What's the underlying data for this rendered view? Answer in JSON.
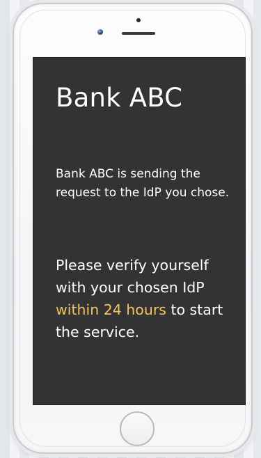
{
  "screen": {
    "title": "Bank ABC",
    "intro": "Bank ABC is sending the request to the IdP you chose.",
    "instruction": {
      "prefix": "Please verify yourself with your chosen IdP ",
      "highlight": "within 24 hours",
      "suffix": " to start the service."
    }
  },
  "colors": {
    "screen_background": "#333333",
    "text": "#ffffff",
    "highlight": "#f3c55b",
    "phone_body": "#f7f7f8"
  },
  "icons": {
    "camera": "front-camera-icon",
    "home": "home-button-icon"
  }
}
